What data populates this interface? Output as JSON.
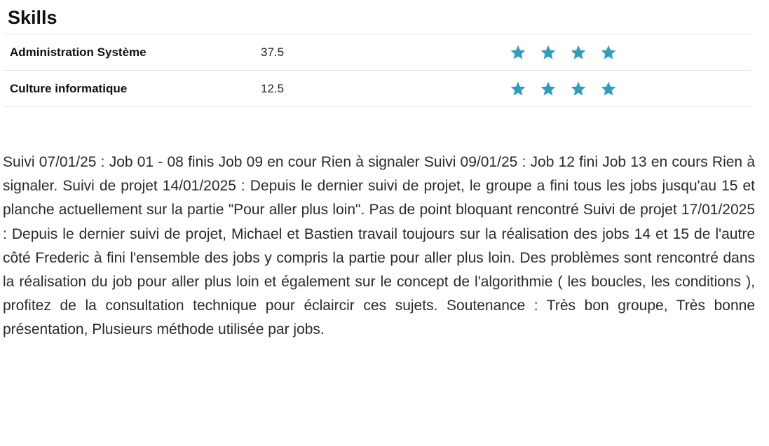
{
  "skills": {
    "title": "Skills",
    "rows": [
      {
        "name": "Administration Système",
        "score": "37.5",
        "stars_filled": 4,
        "stars_total": 4
      },
      {
        "name": "Culture informatique",
        "score": "12.5",
        "stars_filled": 4,
        "stars_total": 4
      }
    ],
    "star_icon": "star-icon",
    "star_color": "#2a9fc0"
  },
  "comment": {
    "text": "Suivi 07/01/25 : Job 01 - 08 finis Job 09 en cour Rien à signaler Suivi 09/01/25 : Job 12 fini Job 13 en cours Rien à signaler. Suivi de projet 14/01/2025 : Depuis le dernier suivi de projet, le groupe a fini tous les jobs jusqu'au 15 et planche actuellement sur la partie \"Pour aller plus loin\". Pas de point bloquant rencontré Suivi de projet 17/01/2025 : Depuis le dernier suivi de projet, Michael et Bastien travail toujours sur la réalisation des jobs 14 et 15 de l'autre côté Frederic à fini l'ensemble des jobs y compris la partie pour aller plus loin. Des problèmes sont rencontré dans la réalisation du job pour aller plus loin et également sur le concept de l'algorithmie ( les boucles, les conditions ), profitez de la consultation technique pour éclaircir ces sujets. Soutenance : Très bon groupe, Très bonne présentation, Plusieurs méthode utilisée par jobs."
  }
}
